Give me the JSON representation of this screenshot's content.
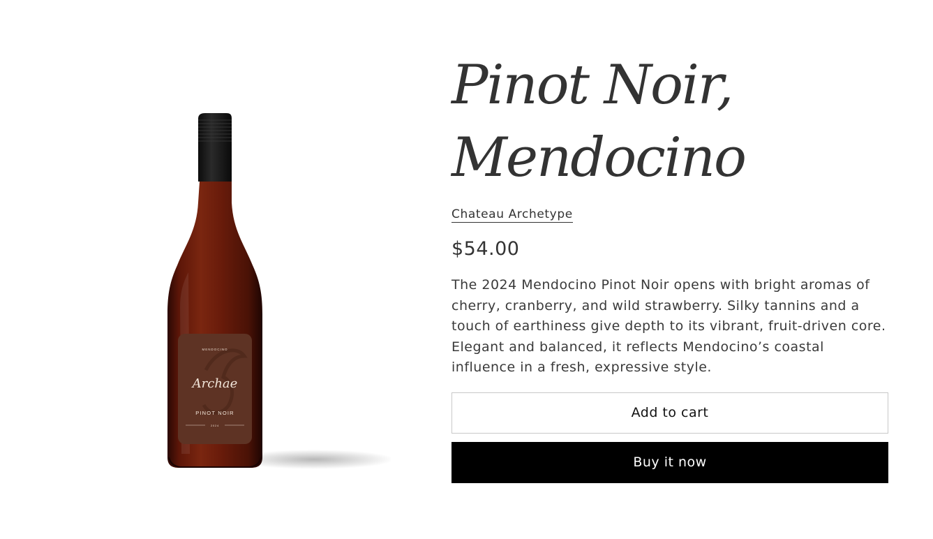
{
  "product": {
    "title_line_1": "Pinot Noir,",
    "title_line_2": "Mendocino",
    "vendor": "Chateau Archetype",
    "price": "$54.00",
    "description": "The 2024 Mendocino Pinot Noir opens with bright aromas of cherry, cranberry, and wild strawberry. Silky tannins and a touch of earthiness give depth to its vibrant, fruit-driven core. Elegant and balanced, it reflects Mendocino’s coastal influence in a fresh, expressive style."
  },
  "label": {
    "region": "MENDOCINO",
    "brand": "Archae",
    "varietal": "PINOT NOIR",
    "vintage": "2024"
  },
  "actions": {
    "add_to_cart": "Add to cart",
    "buy_now": "Buy it now"
  },
  "colors": {
    "wine": "#5a1a0f",
    "label": "#5e3324",
    "capsule": "#1a1a1a",
    "buy_button": "#000000"
  }
}
